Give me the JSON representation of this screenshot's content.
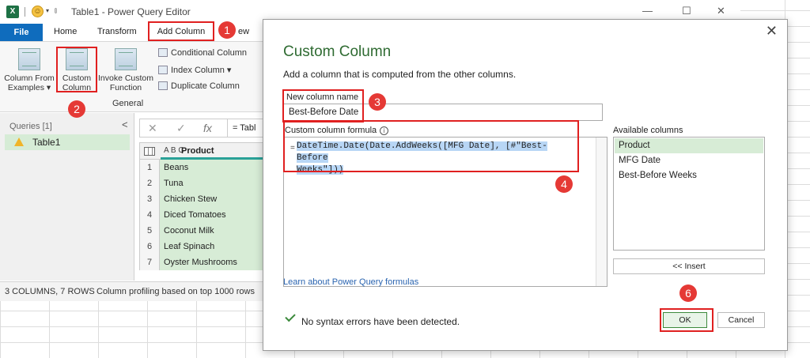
{
  "window": {
    "title": "Table1 - Power Query Editor",
    "qa_more": "▾",
    "smiley": "☺",
    "minimize": "—",
    "maximize": "☐",
    "close": "✕"
  },
  "ribbon_tabs": {
    "file": "File",
    "home": "Home",
    "transform": "Transform",
    "add_column": "Add Column",
    "view_partial": "ew"
  },
  "ribbon": {
    "column_from_examples": [
      "Column From",
      "Examples ▾"
    ],
    "custom_column": [
      "Custom",
      "Column"
    ],
    "invoke_custom_function": [
      "Invoke Custom",
      "Function"
    ],
    "conditional_column": "Conditional Column",
    "index_column": "Index Column ▾",
    "duplicate_column": "Duplicate Column",
    "group_label": "General"
  },
  "queries": {
    "title": "Queries [1]",
    "collapse": "<",
    "items": [
      "Table1"
    ]
  },
  "formula_bar": {
    "cancel": "✕",
    "commit": "✓",
    "fx": "fx",
    "text": "= Tabl"
  },
  "table": {
    "type_icon": "A B C",
    "column": "Product",
    "rows": [
      {
        "n": "1",
        "v": "Beans"
      },
      {
        "n": "2",
        "v": "Tuna"
      },
      {
        "n": "3",
        "v": "Chicken Stew"
      },
      {
        "n": "4",
        "v": "Diced Tomatoes"
      },
      {
        "n": "5",
        "v": "Coconut Milk"
      },
      {
        "n": "6",
        "v": "Leaf Spinach"
      },
      {
        "n": "7",
        "v": "Oyster Mushrooms"
      }
    ]
  },
  "statusbar": {
    "left": "3 COLUMNS, 7 ROWS",
    "right": "Column profiling based on top 1000 rows"
  },
  "dialog": {
    "close": "✕",
    "title": "Custom Column",
    "subtitle": "Add a column that is computed from the other columns.",
    "new_column_label": "New column name",
    "new_column_value": "Best-Before Date",
    "formula_label": "Custom column formula",
    "info": "i",
    "formula_eq": "=",
    "formula_line1": "DateTime.Date(Date.AddWeeks([MFG Date], [#\"Best-Before",
    "formula_line2": "Weeks\"]))",
    "available_label": "Available columns",
    "available_columns": [
      "Product",
      "MFG Date",
      "Best-Before Weeks"
    ],
    "insert_button": "<< Insert",
    "learn_link": "Learn about Power Query formulas",
    "status_message": "No syntax errors have been detected.",
    "ok_button": "OK",
    "cancel_button": "Cancel"
  },
  "badges": [
    "1",
    "2",
    "3",
    "4",
    "6"
  ],
  "colors": {
    "highlight_red": "#e02020",
    "badge_red": "#e53935",
    "file_tab_blue": "#0f6cbd",
    "dialog_title_green": "#2f6b32",
    "selection_green": "#d7ecd6",
    "formula_selection_blue": "#b8d6f5"
  }
}
